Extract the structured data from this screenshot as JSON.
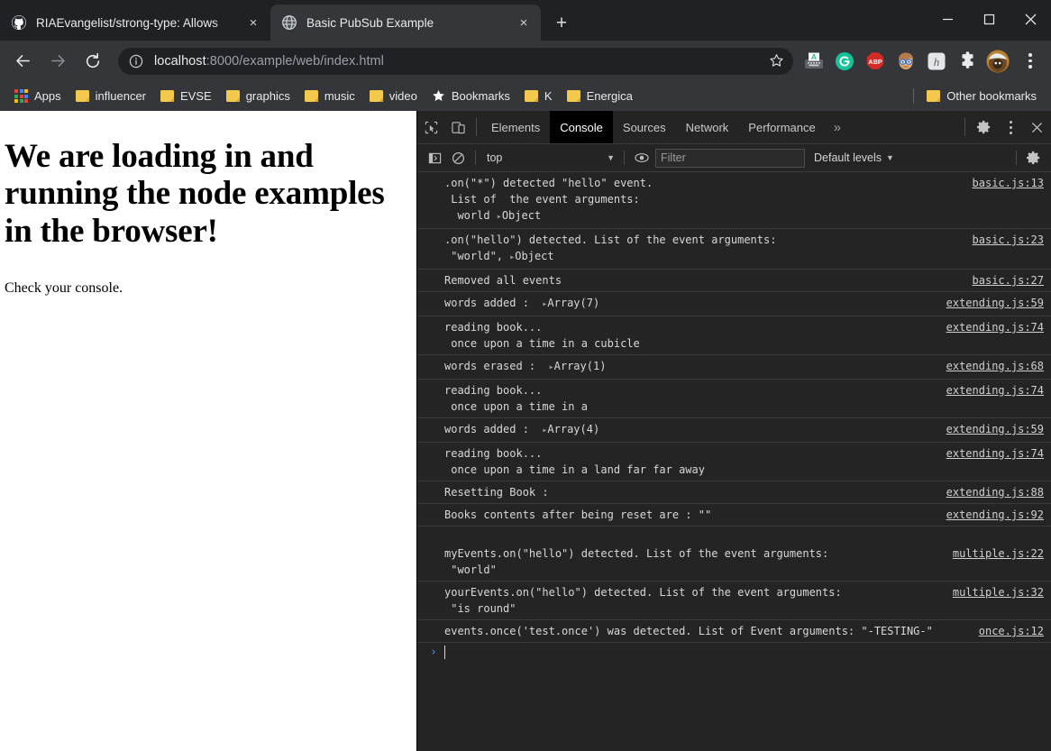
{
  "window": {
    "minimize_label": "Minimize",
    "maximize_label": "Maximize",
    "close_label": "Close"
  },
  "tabs": [
    {
      "title": "RIAEvangelist/strong-type: Allows",
      "favicon": "github-icon",
      "active": false,
      "close_label": "×"
    },
    {
      "title": "Basic PubSub Example",
      "favicon": "globe-icon",
      "active": true,
      "close_label": "×"
    }
  ],
  "new_tab_label": "+",
  "toolbar": {
    "back_label": "←",
    "forward_label": "→",
    "reload_label": "↻",
    "url_host": "localhost",
    "url_rest": ":8000/example/web/index.html",
    "url_full": "localhost:8000/example/web/index.html",
    "info_icon": "info-circle-icon",
    "star_icon": "bookmark-star-icon",
    "extensions": [
      {
        "name": "grammarly-typewriter-icon",
        "label": "A"
      },
      {
        "name": "grammarly-icon",
        "label": "G"
      },
      {
        "name": "adblock-plus-icon",
        "label": "ABP"
      },
      {
        "name": "honey-avatar-icon",
        "label": ""
      },
      {
        "name": "honey-icon",
        "label": "h"
      },
      {
        "name": "extensions-puzzle-icon",
        "label": ""
      }
    ],
    "profile_icon": "profile-avatar",
    "menu_icon": "chrome-menu-icon"
  },
  "bookmarks": {
    "apps_label": "Apps",
    "items": [
      {
        "label": "influencer",
        "icon": "folder-icon"
      },
      {
        "label": "EVSE",
        "icon": "folder-icon"
      },
      {
        "label": "graphics",
        "icon": "folder-icon"
      },
      {
        "label": "music",
        "icon": "folder-icon"
      },
      {
        "label": "video",
        "icon": "folder-icon"
      },
      {
        "label": "Bookmarks",
        "icon": "star-icon"
      },
      {
        "label": "K",
        "icon": "folder-icon"
      },
      {
        "label": "Energica",
        "icon": "folder-icon"
      }
    ],
    "other_label": "Other bookmarks",
    "other_icon": "folder-icon"
  },
  "page": {
    "heading": "We are loading in and running the node examples in the browser!",
    "paragraph": "Check your console."
  },
  "devtools": {
    "inspect_icon": "inspect-cursor-icon",
    "device_icon": "device-toolbar-icon",
    "tabs": [
      {
        "label": "Elements",
        "selected": false
      },
      {
        "label": "Console",
        "selected": true
      },
      {
        "label": "Sources",
        "selected": false
      },
      {
        "label": "Network",
        "selected": false
      },
      {
        "label": "Performance",
        "selected": false
      }
    ],
    "more_tabs_label": "»",
    "settings_icon": "gear-icon",
    "kebab_icon": "more-options-icon",
    "close_icon": "close-devtools-icon",
    "filterbar": {
      "sidebar_toggle_icon": "console-sidebar-icon",
      "clear_icon": "clear-console-icon",
      "context": "top",
      "eye_icon": "live-expression-icon",
      "filter_placeholder": "Filter",
      "filter_value": "",
      "levels_label": "Default levels",
      "settings_icon": "console-settings-icon"
    },
    "console": {
      "messages": [
        {
          "source": "basic.js:13",
          "source_on_own_line": true,
          "lines": [
            {
              "text": ".on(\"*\") detected \"hello\" event."
            },
            {
              "text": " List of  the event arguments:"
            },
            {
              "text": "  world ",
              "has_triangle": true,
              "after": "Object"
            }
          ]
        },
        {
          "source": "basic.js:23",
          "source_on_own_line": false,
          "lines": [
            {
              "text": ".on(\"hello\") detected. List of the event arguments:"
            },
            {
              "text": " \"world\", ",
              "has_triangle": true,
              "after": "Object"
            }
          ]
        },
        {
          "source": "basic.js:27",
          "source_on_own_line": false,
          "lines": [
            {
              "text": "Removed all events"
            }
          ]
        },
        {
          "source": "extending.js:59",
          "source_on_own_line": false,
          "lines": [
            {
              "text": "words added :  ",
              "has_triangle": true,
              "after": "Array(7)"
            }
          ]
        },
        {
          "source": "extending.js:74",
          "source_on_own_line": false,
          "lines": [
            {
              "text": "reading book..."
            },
            {
              "text": " once upon a time in a cubicle"
            }
          ]
        },
        {
          "source": "extending.js:68",
          "source_on_own_line": false,
          "lines": [
            {
              "text": "words erased :  ",
              "has_triangle": true,
              "after": "Array(1)"
            }
          ]
        },
        {
          "source": "extending.js:74",
          "source_on_own_line": false,
          "lines": [
            {
              "text": "reading book..."
            },
            {
              "text": " once upon a time in a"
            }
          ]
        },
        {
          "source": "extending.js:59",
          "source_on_own_line": false,
          "lines": [
            {
              "text": "words added :  ",
              "has_triangle": true,
              "after": "Array(4)"
            }
          ]
        },
        {
          "source": "extending.js:74",
          "source_on_own_line": false,
          "lines": [
            {
              "text": "reading book..."
            },
            {
              "text": " once upon a time in a land far far away"
            }
          ]
        },
        {
          "source": "extending.js:88",
          "source_on_own_line": true,
          "lines": [
            {
              "text": ""
            },
            {
              "text": "Resetting Book :"
            }
          ]
        },
        {
          "source": "extending.js:92",
          "source_on_own_line": false,
          "lines": [
            {
              "text": "Books contents after being reset are : \"\""
            }
          ]
        },
        {
          "source": "multiple.js:22",
          "source_on_own_line": false,
          "blank_before": true,
          "lines": [
            {
              "text": "myEvents.on(\"hello\") detected. List of the event arguments:"
            },
            {
              "text": " \"world\""
            }
          ]
        },
        {
          "source": "multiple.js:32",
          "source_on_own_line": false,
          "lines": [
            {
              "text": "yourEvents.on(\"hello\") detected. List of the event arguments:"
            },
            {
              "text": " \"is round\""
            }
          ]
        },
        {
          "source": "once.js:12",
          "source_on_own_line": true,
          "lines": [
            {
              "text": ""
            },
            {
              "text": "events.once('test.once') was detected. List of Event arguments: \"-TESTING-\""
            }
          ]
        }
      ],
      "prompt_arrow": "›",
      "prompt_value": ""
    }
  },
  "colors": {
    "chrome_bg": "#202124",
    "toolbar_bg": "#35363a",
    "devtools_bg": "#242424",
    "devtools_selected_tab_bg": "#000000",
    "folder_yellow": "#f2c94c",
    "prompt_blue": "#4f8df7",
    "page_bg": "#ffffff"
  }
}
